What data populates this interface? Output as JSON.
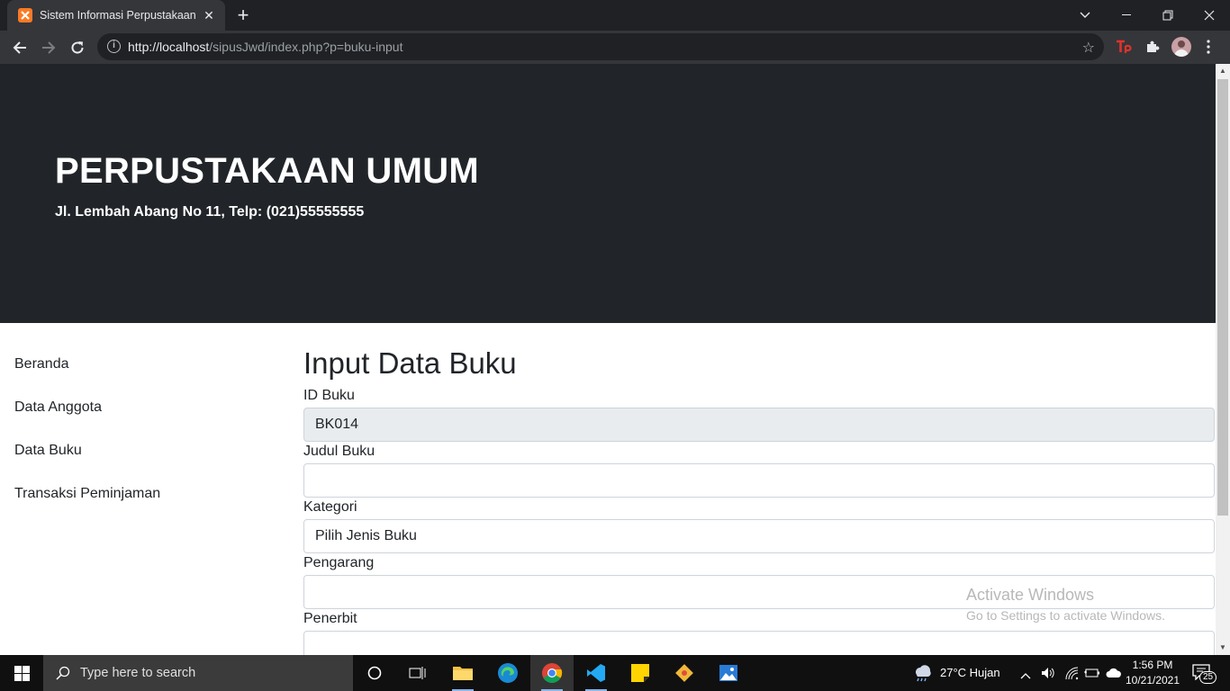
{
  "browser": {
    "tab_title": "Sistem Informasi Perpustakaan",
    "tab_close": "✕",
    "new_tab": "+",
    "url_host": "http://localhost",
    "url_path": "/sipusJwd/index.php?p=buku-input"
  },
  "header": {
    "title": "PERPUSTAKAAN UMUM",
    "subtitle": "Jl. Lembah Abang No 11, Telp: (021)55555555"
  },
  "sidebar": {
    "items": [
      {
        "label": "Beranda"
      },
      {
        "label": "Data Anggota"
      },
      {
        "label": "Data Buku"
      },
      {
        "label": "Transaksi Peminjaman"
      }
    ]
  },
  "form": {
    "title": "Input Data Buku",
    "fields": [
      {
        "label": "ID Buku",
        "value": "BK014"
      },
      {
        "label": "Judul Buku",
        "value": ""
      },
      {
        "label": "Kategori",
        "value": "Pilih Jenis Buku"
      },
      {
        "label": "Pengarang",
        "value": ""
      },
      {
        "label": "Penerbit",
        "value": ""
      }
    ]
  },
  "watermark": {
    "title": "Activate Windows",
    "subtitle": "Go to Settings to activate Windows."
  },
  "taskbar": {
    "search_placeholder": "Type here to search",
    "weather": "27°C  Hujan",
    "time": "1:56 PM",
    "date": "10/21/2021",
    "notifications": "25"
  },
  "colors": {
    "jumbotron": "#212529",
    "browser_frame": "#202124",
    "toolbar": "#35363a"
  }
}
